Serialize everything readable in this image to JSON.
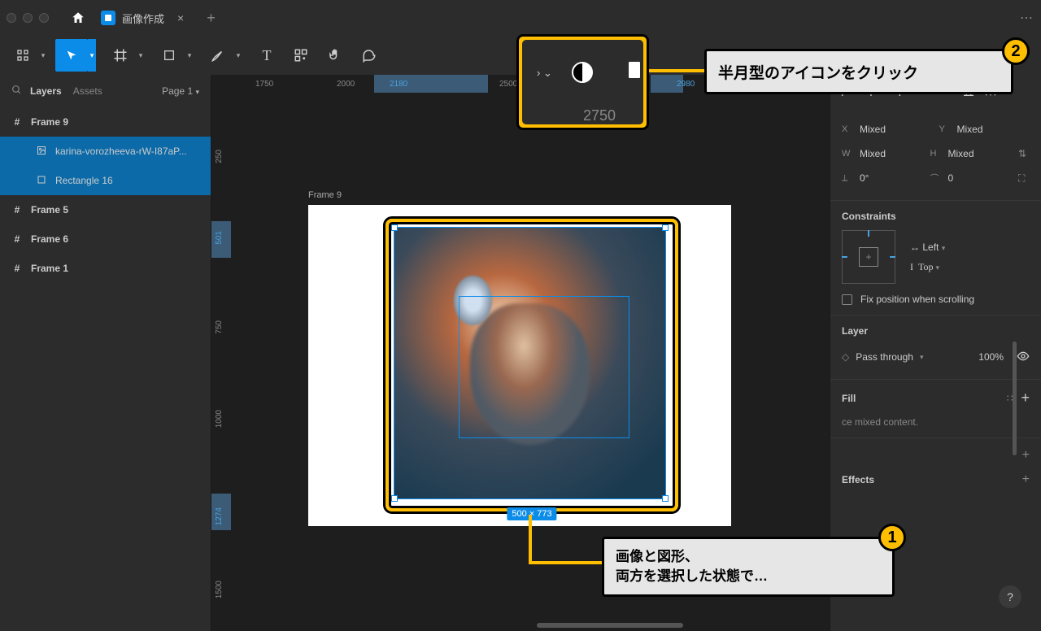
{
  "tab": {
    "title": "画像作成"
  },
  "left": {
    "layers_label": "Layers",
    "assets_label": "Assets",
    "page_label": "Page 1",
    "items": [
      {
        "icon": "#",
        "label": "Frame 9",
        "bold": true,
        "sel": false,
        "indent": 0
      },
      {
        "icon": "img",
        "label": "karina-vorozheeva-rW-I87aP...",
        "bold": false,
        "sel": true,
        "indent": 1
      },
      {
        "icon": "rect",
        "label": "Rectangle 16",
        "bold": false,
        "sel": true,
        "indent": 1
      },
      {
        "icon": "#",
        "label": "Frame 5",
        "bold": true,
        "sel": false,
        "indent": 0
      },
      {
        "icon": "#",
        "label": "Frame 6",
        "bold": true,
        "sel": false,
        "indent": 0
      },
      {
        "icon": "#",
        "label": "Frame 1",
        "bold": true,
        "sel": false,
        "indent": 0
      }
    ]
  },
  "ruler_h": [
    "1750",
    "2000",
    "2180",
    "2500",
    "2750",
    "2980"
  ],
  "ruler_v": [
    "250",
    "501",
    "750",
    "1000",
    "1274",
    "1500"
  ],
  "ruler_big_center": "2750",
  "canvas": {
    "frame_label": "Frame 9",
    "dims": "500 × 773"
  },
  "right": {
    "x": "Mixed",
    "y": "Mixed",
    "w": "Mixed",
    "h": "Mixed",
    "rotation": "0°",
    "radius": "0",
    "constraints_title": "Constraints",
    "constraint_h": "Left",
    "constraint_v": "Top",
    "fix_label": "Fix position when scrolling",
    "layer_title": "Layer",
    "blend": "Pass through",
    "opacity": "100%",
    "fill_title": "Fill",
    "fill_msg": "ce mixed content.",
    "effects_title": "Effects"
  },
  "tips": {
    "t1_l1": "画像と図形、",
    "t1_l2": "両方を選択した状態で…",
    "t2": "半月型のアイコンをクリック"
  }
}
